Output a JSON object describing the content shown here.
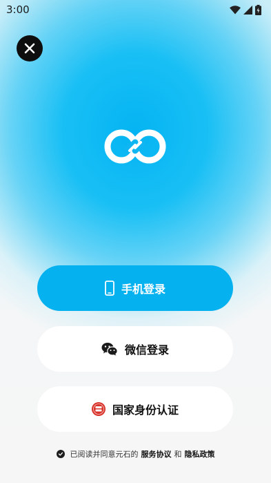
{
  "status_bar": {
    "time": "3:00",
    "icons": [
      "wifi-icon",
      "signal-icon",
      "battery-icon"
    ]
  },
  "close": {
    "icon": "close-icon"
  },
  "logo": {
    "icon": "app-logo"
  },
  "login_options": [
    {
      "label": "手机登录",
      "icon": "phone-icon"
    },
    {
      "label": "微信登录",
      "icon": "wechat-icon"
    },
    {
      "label": "国家身份认证",
      "icon": "national-id-icon"
    }
  ],
  "agreement": {
    "prefix": "已阅读并同意元石的",
    "terms": "服务协议",
    "conjunction": "和",
    "privacy": "隐私政策"
  },
  "colors": {
    "accent": "#05b1ef",
    "dark": "#0e0e0e"
  }
}
